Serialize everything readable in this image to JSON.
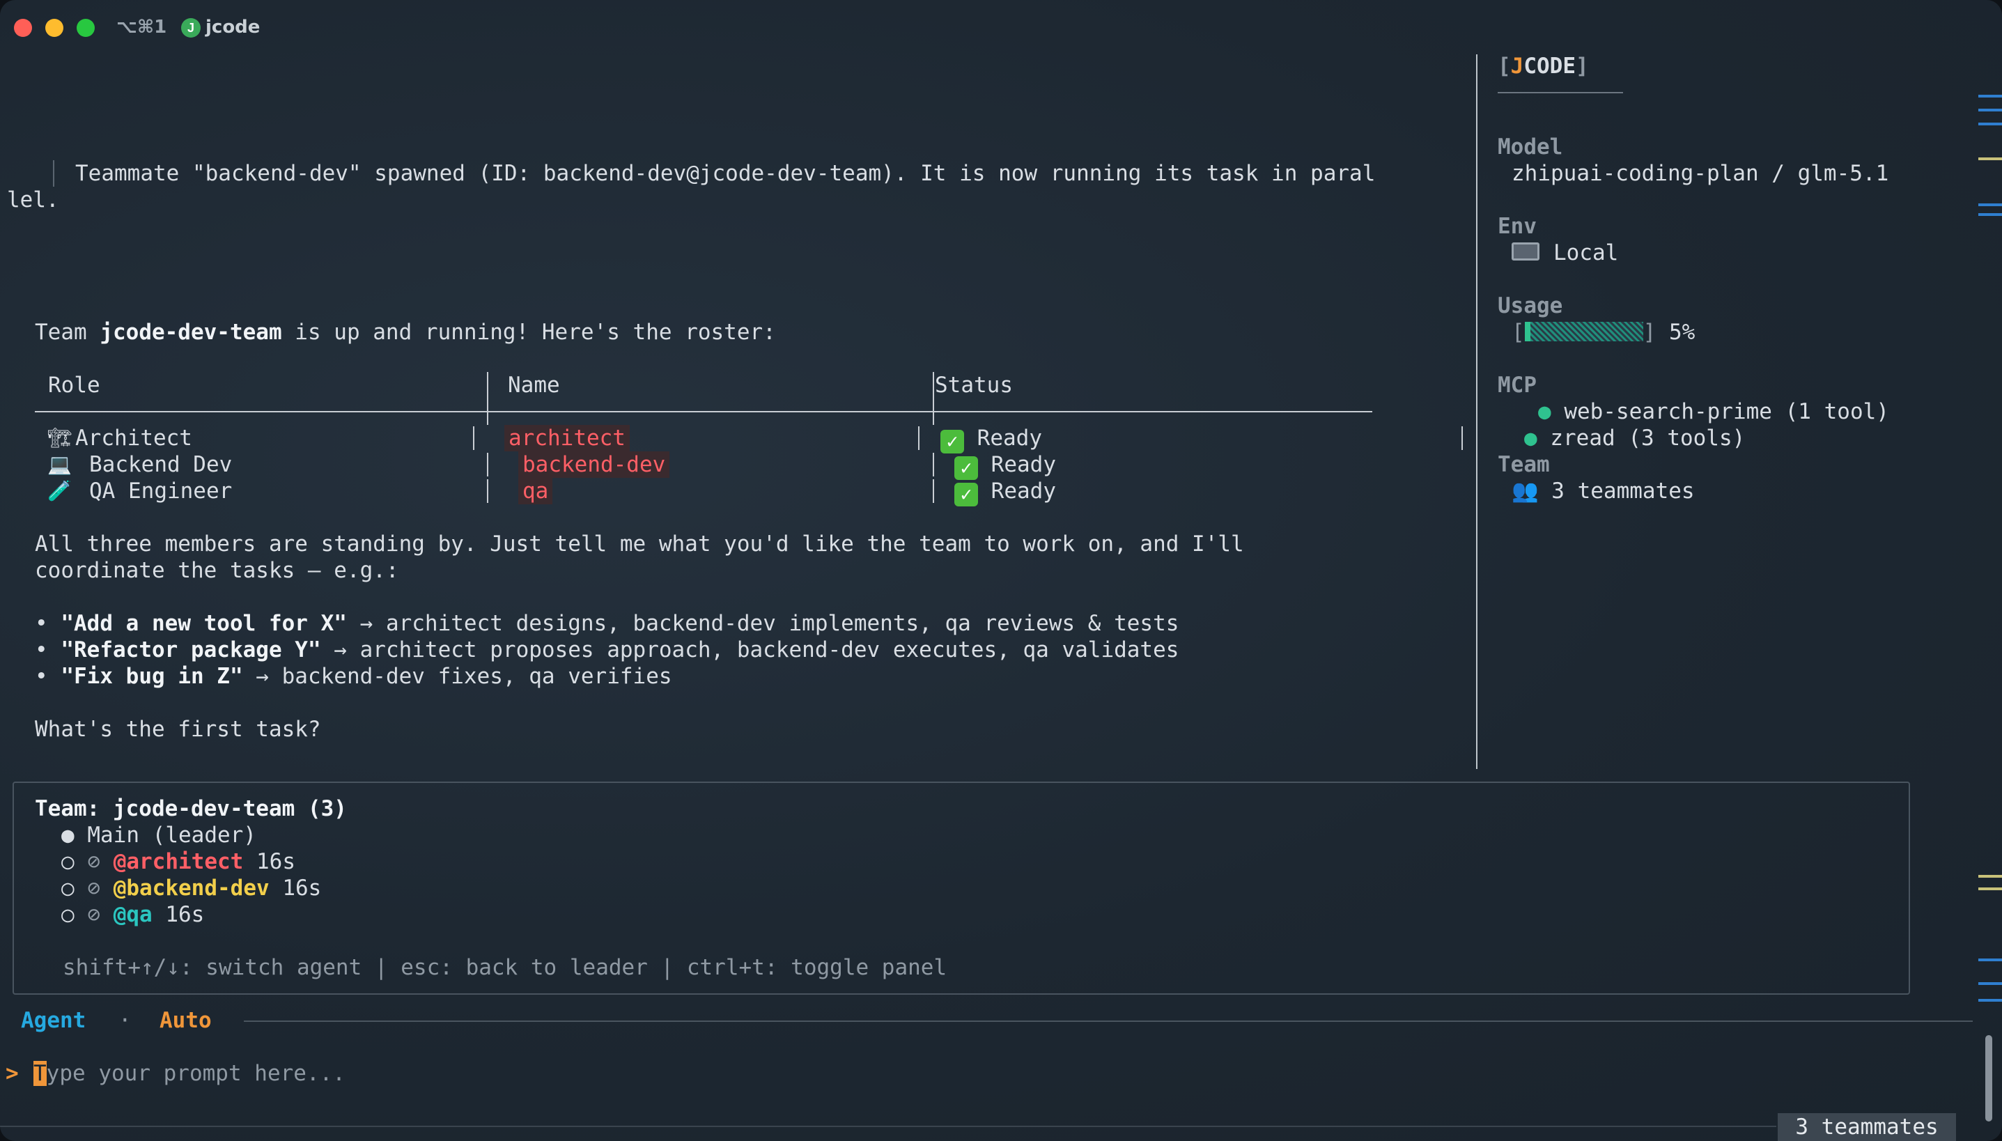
{
  "titlebar": {
    "shortcut": "⌥⌘1",
    "app_initial": "J",
    "app_name": "jcode"
  },
  "spawn_message": {
    "line1": "Teammate \"backend-dev\" spawned (ID: backend-dev@jcode-dev-team). It is now running its task in paral",
    "line2": "lel."
  },
  "intro": {
    "prefix": "Team ",
    "team": "jcode-dev-team",
    "suffix": " is up and running! Here's the roster:"
  },
  "table": {
    "headers": [
      "Role",
      "Name",
      "Status"
    ],
    "rows": [
      {
        "icon": "🏗",
        "role": "Architect",
        "name": "architect",
        "status": "Ready"
      },
      {
        "icon": "💻",
        "role": "Backend Dev",
        "name": "backend-dev",
        "status": "Ready"
      },
      {
        "icon": "🧪",
        "role": "QA Engineer",
        "name": "qa",
        "status": "Ready"
      }
    ]
  },
  "standby": {
    "line1": "All three members are standing by. Just tell me what you'd like the team to work on, and I'll",
    "line2": "coordinate the tasks — e.g.:"
  },
  "examples": [
    {
      "bullet": "•",
      "task": "\"Add a new tool for X\"",
      "desc": " → architect designs, backend-dev implements, qa reviews & tests"
    },
    {
      "bullet": "•",
      "task": "\"Refactor package Y\"",
      "desc": " → architect proposes approach, backend-dev executes, qa validates"
    },
    {
      "bullet": "•",
      "task": "\"Fix bug in Z\"",
      "desc": " → backend-dev fixes, qa verifies"
    }
  ],
  "question": "What's the first task?",
  "sidebar": {
    "logo_open": "[",
    "logo_j": "J",
    "logo_rest": "CODE",
    "logo_close": "]",
    "model_label": "Model",
    "model_value": "zhipuai-coding-plan / glm-5.1",
    "env_label": "Env",
    "env_value": "Local",
    "usage_label": "Usage",
    "usage_open": "[",
    "usage_close": "]",
    "usage_percent": "5%",
    "usage_fraction": 0.05,
    "mcp_label": "MCP",
    "mcp_items": [
      {
        "dot": "●",
        "name": "web-search-prime (1 tool)"
      },
      {
        "dot": "●",
        "name": "zread (3 tools)"
      }
    ],
    "team_label": "Team",
    "team_value": "3 teammates"
  },
  "team_panel": {
    "title": "Team: jcode-dev-team (3)",
    "members": [
      {
        "marker": "●",
        "status_icon": "",
        "name": "Main (leader)",
        "time": ""
      },
      {
        "marker": "○",
        "status_icon": "⊘",
        "name": "@architect",
        "time": " 16s"
      },
      {
        "marker": "○",
        "status_icon": "⊘",
        "name": "@backend-dev",
        "time": " 16s"
      },
      {
        "marker": "○",
        "status_icon": "⊘",
        "name": "@qa",
        "time": " 16s"
      }
    ],
    "hint": "shift+↑/↓: switch agent | esc: back to leader | ctrl+t: toggle panel"
  },
  "mode_bar": {
    "agent": "Agent",
    "separator": "·",
    "mode": "Auto"
  },
  "prompt": {
    "chevron": ">",
    "cursor_char": "T",
    "placeholder": "ype your prompt here..."
  },
  "status_badge": "3 teammates",
  "colors": {
    "accent_orange": "#f0963a",
    "name_red": "#ff5f66",
    "backend_yellow": "#f2cf4b",
    "qa_cyan": "#2bc6c0",
    "agent_blue": "#26a9e0"
  }
}
